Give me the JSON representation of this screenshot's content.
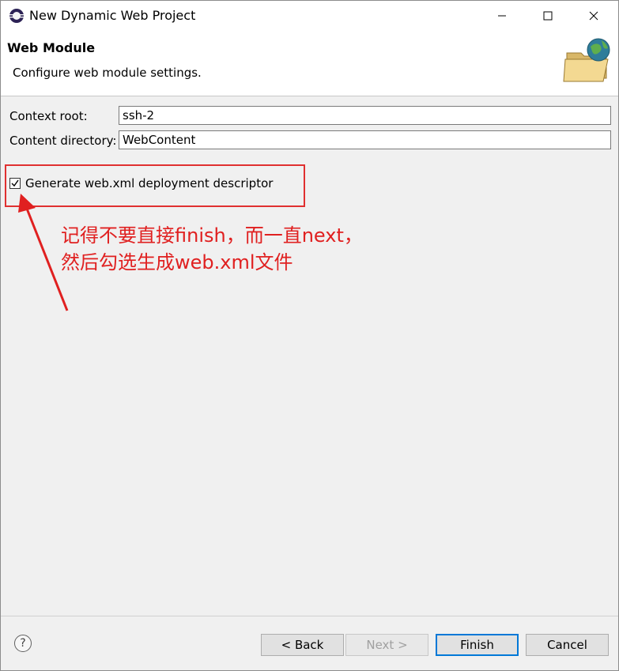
{
  "window": {
    "title": "New Dynamic Web Project",
    "icons": {
      "app": "eclipse-app-icon",
      "minimize": "minimize-icon",
      "maximize": "maximize-icon",
      "close": "close-icon"
    }
  },
  "banner": {
    "title": "Web Module",
    "description": "Configure web module settings.",
    "icon": "folder-globe-icon"
  },
  "form": {
    "context_root_label": "Context root:",
    "context_root_value": "ssh-2",
    "content_dir_label": "Content directory:",
    "content_dir_value": "WebContent",
    "generate_checkbox_label": "Generate web.xml deployment descriptor",
    "generate_checked": true
  },
  "annotation": {
    "line1": "记得不要直接finish，而一直next，",
    "line2": "然后勾选生成web.xml文件",
    "color": "#e02020"
  },
  "footer": {
    "help_icon": "help-icon",
    "back_label": "< Back",
    "next_label": "Next >",
    "finish_label": "Finish",
    "cancel_label": "Cancel"
  },
  "colors": {
    "accent": "#0078d7",
    "annotation": "#e02020"
  }
}
